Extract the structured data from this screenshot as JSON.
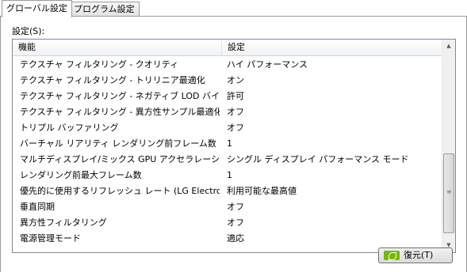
{
  "tabs": [
    {
      "label": "グローバル設定",
      "active": true
    },
    {
      "label": "プログラム設定",
      "active": false
    }
  ],
  "settings_label": "設定(S):",
  "columns": {
    "feature": "機能",
    "setting": "設定"
  },
  "rows": [
    {
      "feature": "テクスチャ フィルタリング - クオリティ",
      "setting": "ハイ パフォーマンス"
    },
    {
      "feature": "テクスチャ フィルタリング - トリリニア最適化",
      "setting": "オン"
    },
    {
      "feature": "テクスチャ フィルタリング - ネガティブ LOD バイアス",
      "setting": "許可"
    },
    {
      "feature": "テクスチャ フィルタリング - 異方性サンプル最適化",
      "setting": "オフ"
    },
    {
      "feature": "トリプル バッファリング",
      "setting": "オフ"
    },
    {
      "feature": "バーチャル リアリティ レンダリング前フレーム数",
      "setting": "1"
    },
    {
      "feature": "マルチディスプレイ/ミックス GPU アクセラレーション",
      "setting": "シングル ディスプレイ パフォーマンス モード"
    },
    {
      "feature": "レンダリング前最大フレーム数",
      "setting": "1"
    },
    {
      "feature": "優先的に使用するリフレッシュ レート (LG Electronic...",
      "setting": "利用可能な最高値"
    },
    {
      "feature": "垂直同期",
      "setting": "オフ"
    },
    {
      "feature": "異方性フィルタリング",
      "setting": "オフ"
    },
    {
      "feature": "電源管理モード",
      "setting": "適応"
    }
  ],
  "scrollbar": {
    "up_icon": "▲",
    "down_icon": "▼",
    "grip": "≡"
  },
  "restore_button": {
    "label": "復元(T)",
    "accent": "#76b900"
  }
}
